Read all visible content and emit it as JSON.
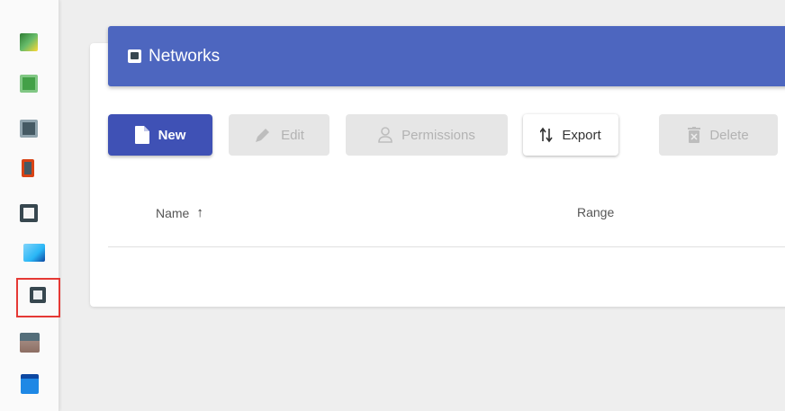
{
  "sidebar": {
    "icons": [
      {
        "name": "dashboard-icon",
        "color": "#2e7d32"
      },
      {
        "name": "chip-icon",
        "color": "#43a047"
      },
      {
        "name": "server-icon",
        "color": "#455a64"
      },
      {
        "name": "device-icon",
        "color": "#d84315"
      },
      {
        "name": "network-port-icon",
        "color": "#37474f"
      },
      {
        "name": "monitor-icon",
        "color": "#29b6f6"
      },
      {
        "name": "networks-icon",
        "color": "#37474f"
      },
      {
        "name": "user-group-icon",
        "color": "#8d6e63"
      },
      {
        "name": "calendar-icon",
        "color": "#1e88e5"
      }
    ],
    "selected_index": 6
  },
  "header": {
    "title": "Networks"
  },
  "toolbar": {
    "new_label": "New",
    "edit_label": "Edit",
    "permissions_label": "Permissions",
    "export_label": "Export",
    "delete_label": "Delete"
  },
  "table": {
    "columns": [
      {
        "label": "Name",
        "sorted": "ascending"
      },
      {
        "label": "Range"
      }
    ],
    "rows": []
  },
  "colors": {
    "header_bg": "#4d66bf",
    "primary": "#3f51b5",
    "selection_outline": "#e53935"
  }
}
